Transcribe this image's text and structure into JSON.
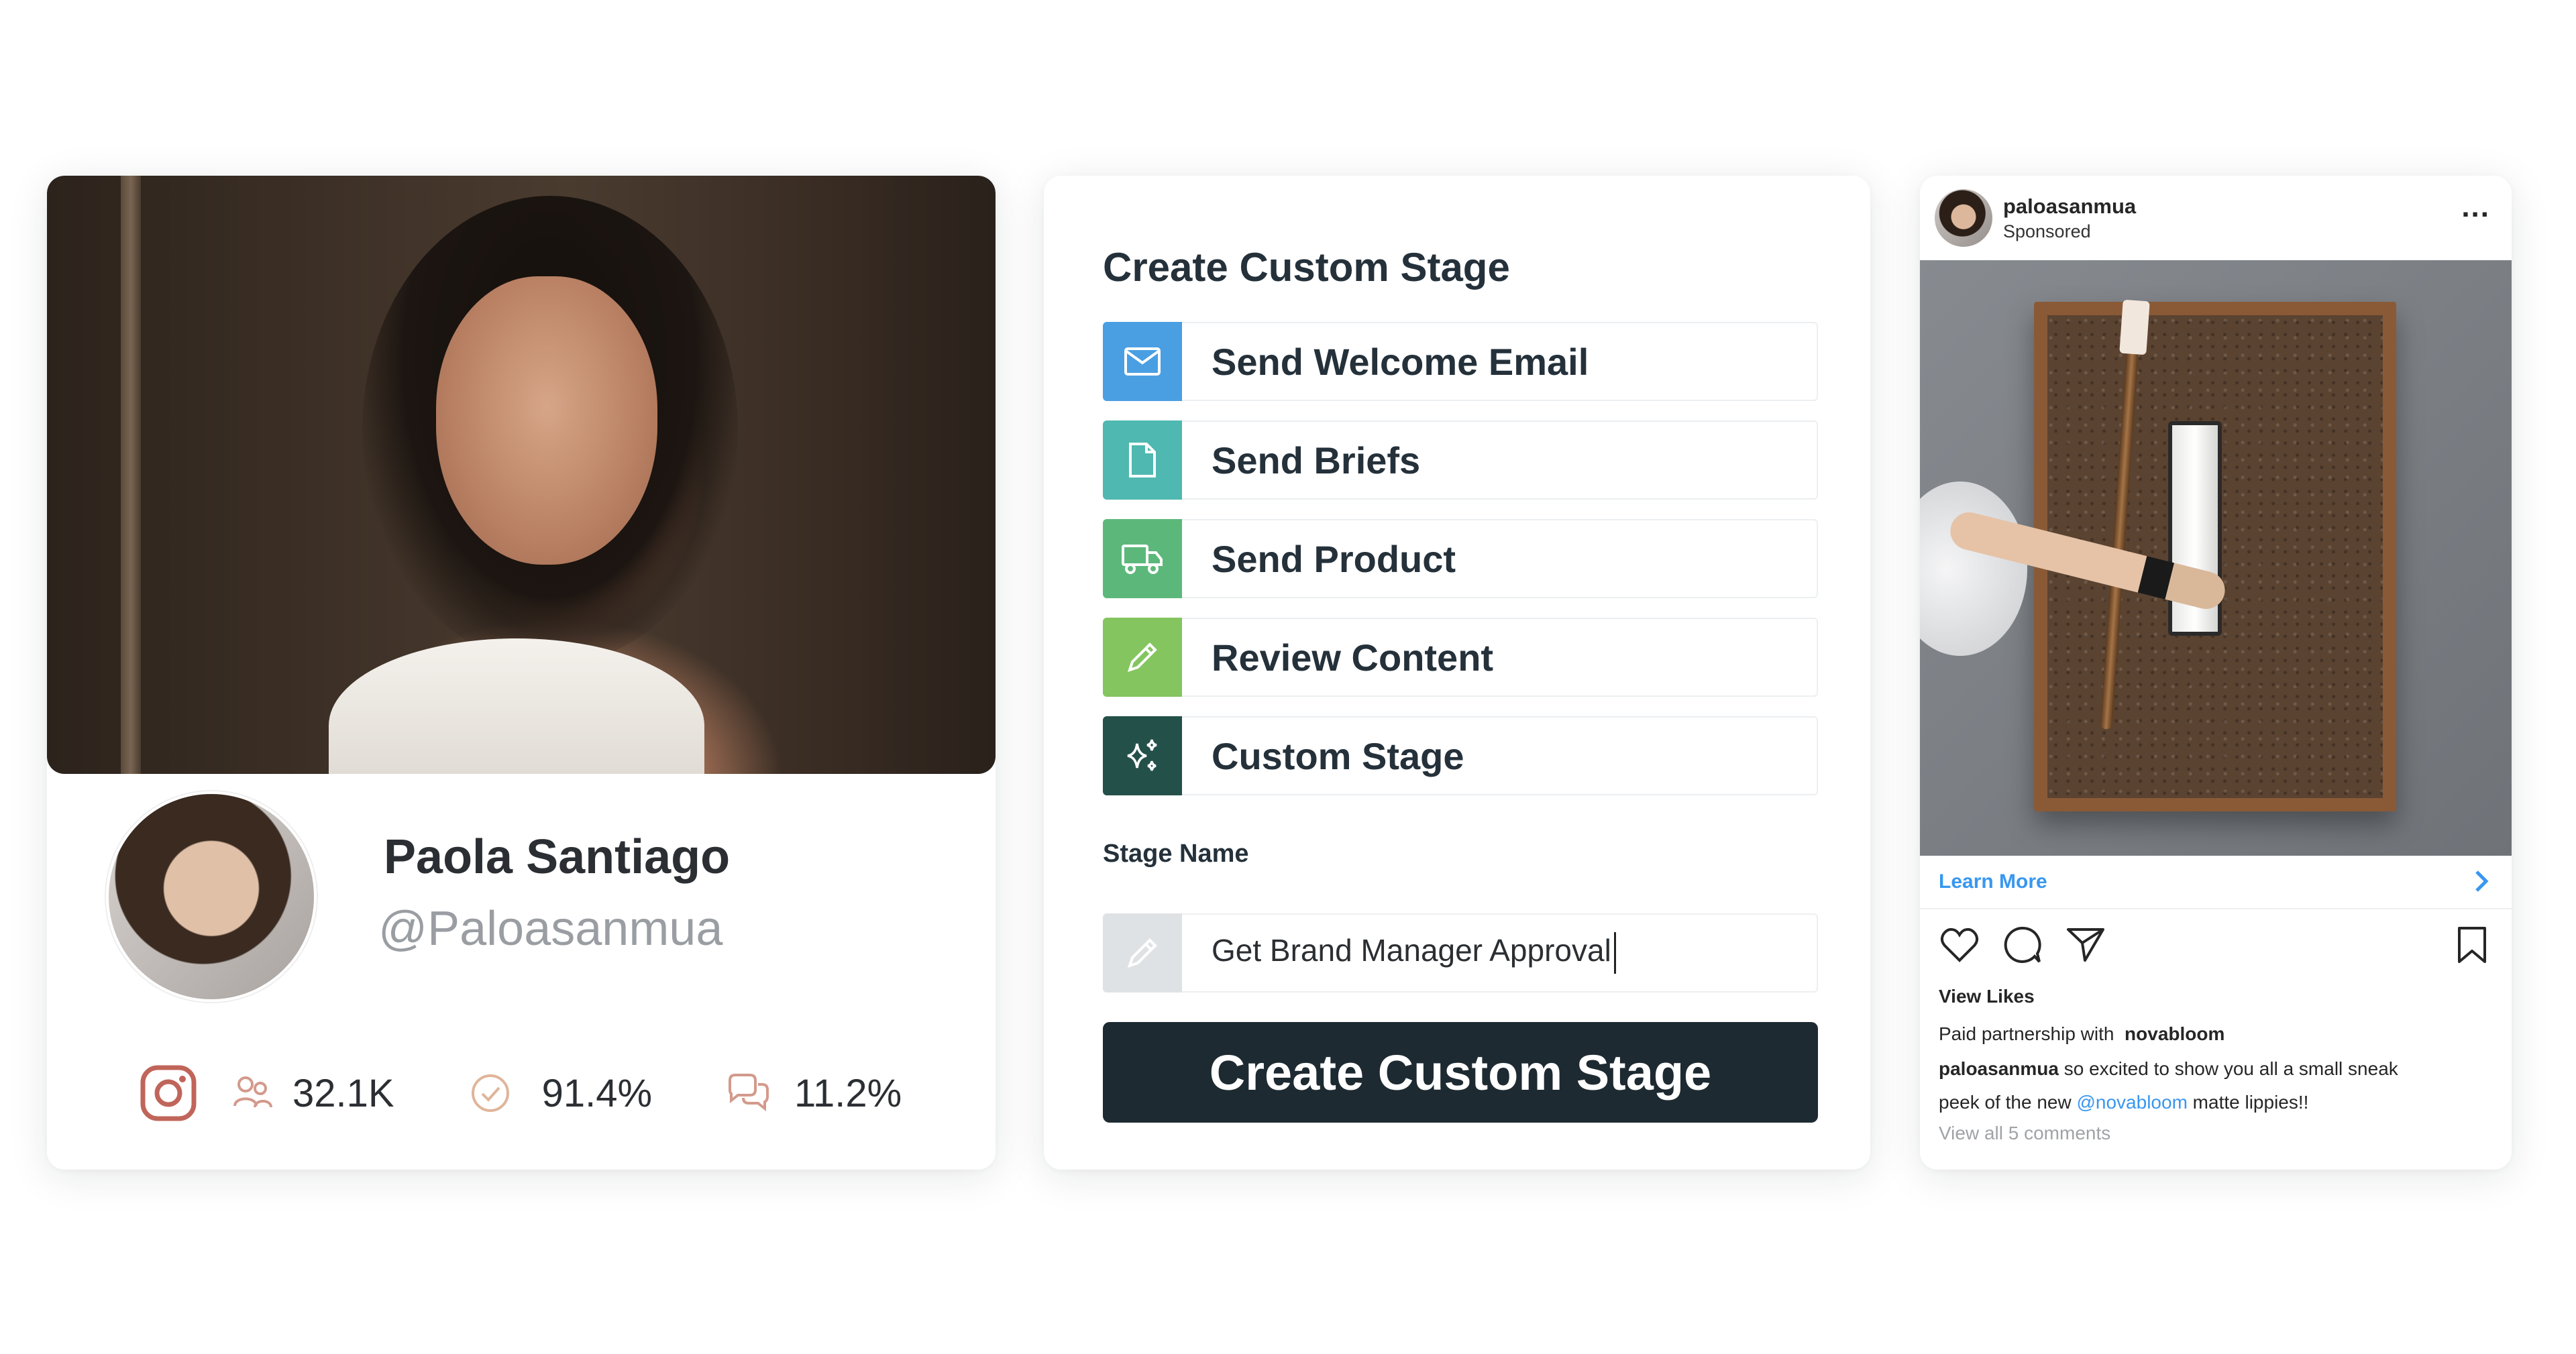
{
  "profile": {
    "name": "Paola Santiago",
    "handle": "@Paloasanmua",
    "stats": {
      "followers": "32.1K",
      "rate": "91.4%",
      "engagement": "11.2%"
    }
  },
  "stage_builder": {
    "title": "Create Custom Stage",
    "options": [
      {
        "label": "Send Welcome Email",
        "icon": "envelope-icon",
        "color": "#4a9fe3"
      },
      {
        "label": "Send Briefs",
        "icon": "document-icon",
        "color": "#4fb8b0"
      },
      {
        "label": "Send Product",
        "icon": "truck-icon",
        "color": "#5cb87a"
      },
      {
        "label": "Review Content",
        "icon": "pencil-icon",
        "color": "#84c55f"
      },
      {
        "label": "Custom Stage",
        "icon": "sparkle-icon",
        "color": "#24504a"
      }
    ],
    "stage_name_label": "Stage Name",
    "stage_name_value": "Get Brand Manager Approval",
    "submit_label": "Create Custom Stage",
    "button_color": "#1d2a31"
  },
  "post": {
    "username": "paloasanmua",
    "sponsored": "Sponsored",
    "more": "...",
    "learn_more": "Learn More",
    "view_likes": "View Likes",
    "partnership_prefix": "Paid partnership with",
    "partner": "novabloom",
    "caption_user": "paloasanmua",
    "caption_text_1": "so excited to show you all a small sneak",
    "caption_text_2_prefix": "peek of the new",
    "caption_mention": "@novabloom",
    "caption_text_2_suffix": "matte lippies!!",
    "view_comments": "View all 5 comments",
    "link_color": "#3897f0"
  }
}
